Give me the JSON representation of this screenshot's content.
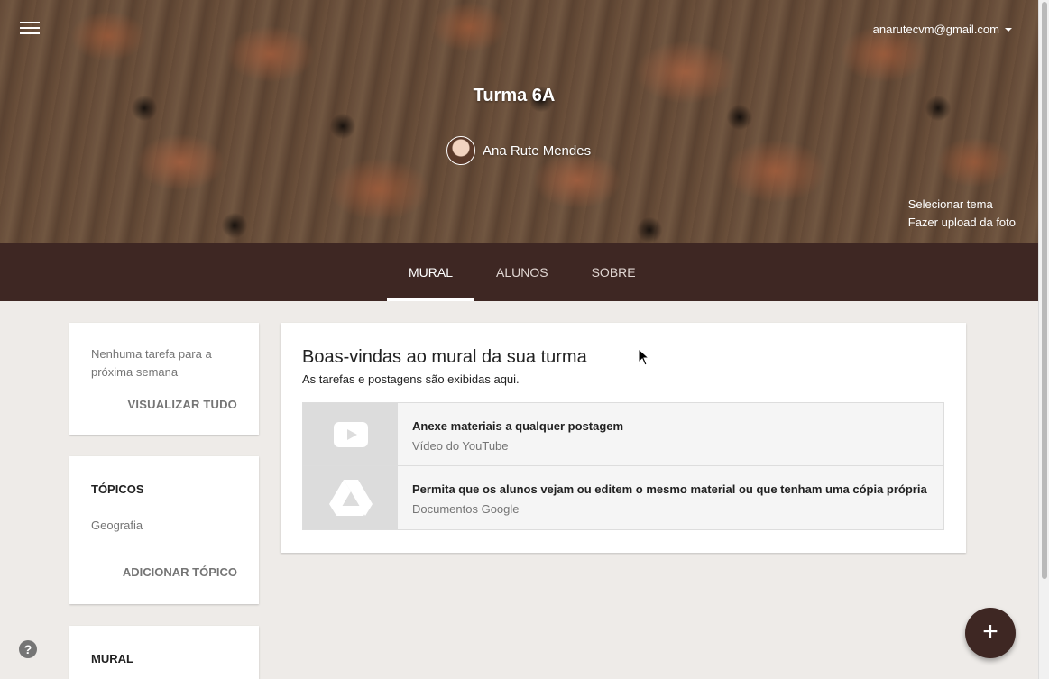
{
  "header": {
    "account_email": "anarutecvm@gmail.com",
    "class_name": "Turma 6A",
    "teacher_name": "Ana Rute Mendes",
    "select_theme": "Selecionar tema",
    "upload_photo": "Fazer upload da foto"
  },
  "tabs": [
    {
      "label": "MURAL",
      "active": true
    },
    {
      "label": "ALUNOS",
      "active": false
    },
    {
      "label": "SOBRE",
      "active": false
    }
  ],
  "upcoming": {
    "message": "Nenhuma tarefa para a próxima semana",
    "view_all": "VISUALIZAR TUDO"
  },
  "topics": {
    "title": "TÓPICOS",
    "items": [
      "Geografia"
    ],
    "add_label": "ADICIONAR TÓPICO"
  },
  "mural_section": {
    "title": "MURAL"
  },
  "welcome": {
    "title": "Boas-vindas ao mural da sua turma",
    "subtitle": "As tarefas e postagens são exibidas aqui.",
    "attachments": [
      {
        "icon": "youtube-icon",
        "title": "Anexe materiais a qualquer postagem",
        "source": "Vídeo do YouTube"
      },
      {
        "icon": "drive-icon",
        "title": "Permita que os alunos vejam ou editem o mesmo material ou que tenham uma cópia própria",
        "source": "Documentos Google"
      }
    ]
  },
  "help": {
    "glyph": "?"
  },
  "fab": {
    "glyph": "+"
  },
  "colors": {
    "theme_dark": "#3e2723",
    "page_bg": "#eeebe8"
  }
}
